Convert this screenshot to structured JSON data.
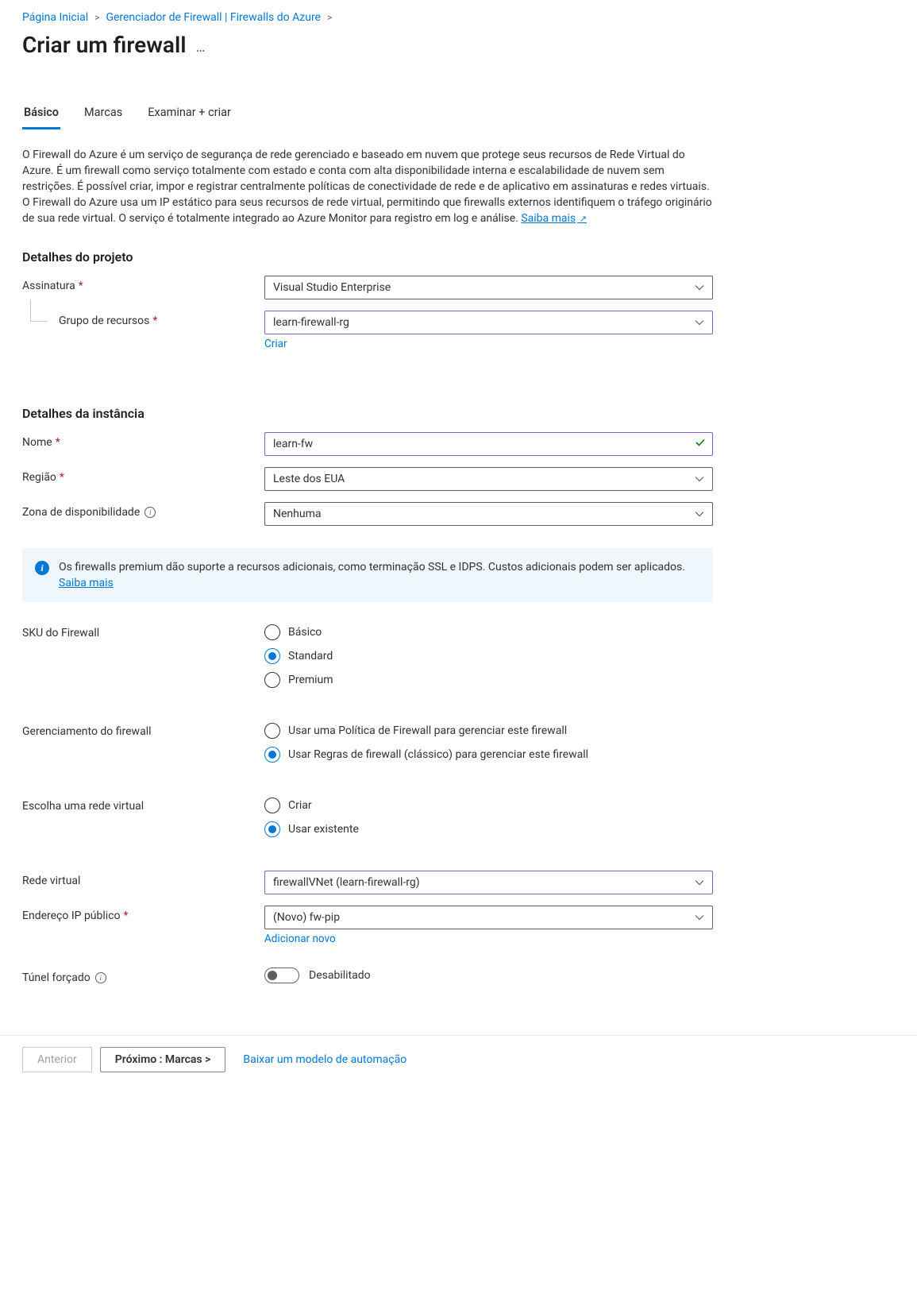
{
  "breadcrumb": {
    "items": [
      "Página Inicial",
      "Gerenciador de Firewall | Firewalls do Azure"
    ]
  },
  "page": {
    "title": "Criar um firewall"
  },
  "tabs": {
    "items": [
      {
        "label": "Básico",
        "active": true
      },
      {
        "label": "Marcas",
        "active": false
      },
      {
        "label": "Examinar + criar",
        "active": false
      }
    ]
  },
  "description": {
    "text": "O Firewall do Azure é um serviço de segurança de rede gerenciado e baseado em nuvem que protege seus recursos de Rede Virtual do Azure. É um firewall como serviço totalmente com estado e conta com alta disponibilidade interna e escalabilidade de nuvem sem restrições. É possível criar, impor e registrar centralmente políticas de conectividade de rede e de aplicativo em assinaturas e redes virtuais. O Firewall do Azure usa um IP estático para seus recursos de rede virtual, permitindo que firewalls externos identifiquem o tráfego originário de sua rede virtual. O serviço é totalmente integrado ao Azure Monitor para registro em log e análise. ",
    "learn_more": "Saiba mais"
  },
  "sections": {
    "project_header": "Detalhes do projeto",
    "subscription_label": "Assinatura",
    "subscription_value": "Visual Studio Enterprise",
    "resource_group_label": "Grupo de recursos",
    "resource_group_value": "learn-firewall-rg",
    "resource_group_create": "Criar",
    "instance_header": "Detalhes da instância",
    "name_label": "Nome",
    "name_value": "learn-fw",
    "region_label": "Região",
    "region_value": "Leste dos EUA",
    "az_label": "Zona de disponibilidade",
    "az_value": "Nenhuma"
  },
  "infobox": {
    "text": "Os firewalls premium dão suporte a recursos adicionais, como terminação SSL e IDPS. Custos adicionais podem ser aplicados.",
    "learn_more": "Saiba mais"
  },
  "sku": {
    "label": "SKU do Firewall",
    "options": [
      "Básico",
      "Standard",
      "Premium"
    ]
  },
  "management": {
    "label": "Gerenciamento do firewall",
    "options": [
      "Usar uma Política de Firewall para gerenciar este firewall",
      "Usar Regras de firewall (clássico) para gerenciar este firewall"
    ]
  },
  "vnet_choice": {
    "label": "Escolha uma rede virtual",
    "options": [
      "Criar",
      "Usar existente"
    ]
  },
  "vnet": {
    "label": "Rede virtual",
    "value": "firewallVNet (learn-firewall-rg)"
  },
  "public_ip": {
    "label": "Endereço IP público",
    "value": "(Novo) fw-pip",
    "add_new": "Adicionar novo"
  },
  "tunnel": {
    "label": "Túnel forçado",
    "status": "Desabilitado"
  },
  "footer": {
    "prev": "Anterior",
    "next": "Próximo : Marcas >",
    "download": "Baixar um modelo de automação"
  }
}
